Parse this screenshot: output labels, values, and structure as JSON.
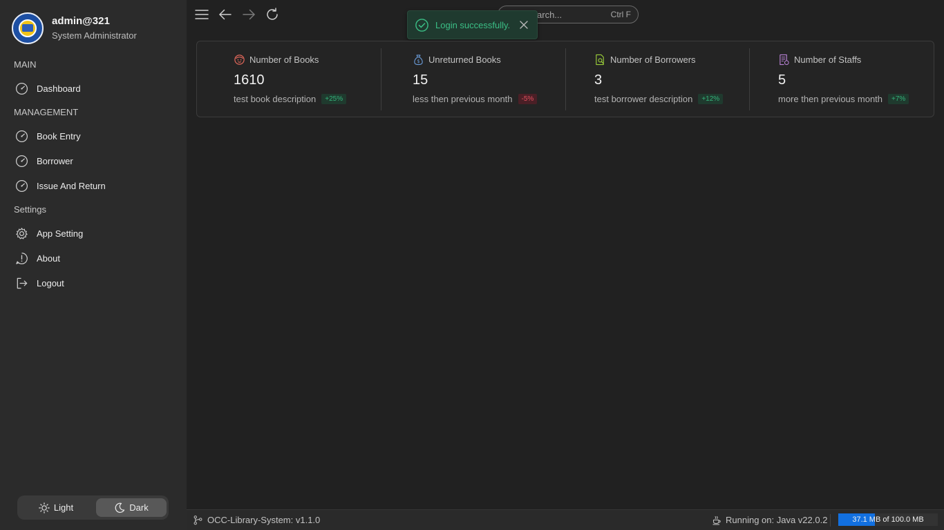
{
  "profile": {
    "name": "admin@321",
    "role": "System Administrator"
  },
  "sections": {
    "main": "MAIN",
    "management": "MANAGEMENT",
    "settings": "Settings"
  },
  "nav": {
    "dashboard": "Dashboard",
    "book_entry": "Book Entry",
    "borrower": "Borrower",
    "issue_return": "Issue And Return",
    "app_setting": "App Setting",
    "about": "About",
    "logout": "Logout"
  },
  "theme": {
    "light": "Light",
    "dark": "Dark",
    "selected": "Dark"
  },
  "search": {
    "placeholder": "Quick Search...",
    "visible_text": "k Search...",
    "shortcut": "Ctrl F"
  },
  "toast": {
    "message": "Login successfully."
  },
  "stats": [
    {
      "title": "Number of Books",
      "value": "1610",
      "desc": "test book description",
      "badge": "+25%",
      "icon": "book-face-icon",
      "color": "#e0675a"
    },
    {
      "title": "Unreturned Books",
      "value": "15",
      "desc": "less then previous month",
      "badge": "-5%",
      "icon": "money-bag-icon",
      "color": "#6a9bd8"
    },
    {
      "title": "Number of Borrowers",
      "value": "3",
      "desc": "test borrower description",
      "badge": "+12%",
      "icon": "document-search-icon",
      "color": "#9bcf3a"
    },
    {
      "title": "Number of Staffs",
      "value": "5",
      "desc": "more then previous month",
      "badge": "+7%",
      "icon": "receipt-icon",
      "color": "#b982d6"
    }
  ],
  "status": {
    "app": "OCC-Library-System: v1.1.0",
    "runtime": "Running on: Java  v22.0.2",
    "memory_text": "37.1 MB of 100.0 MB",
    "memory_fraction": 0.371
  },
  "colors": {
    "accent": "#1270e0",
    "success": "#3bbf86",
    "danger": "#e0505e"
  }
}
